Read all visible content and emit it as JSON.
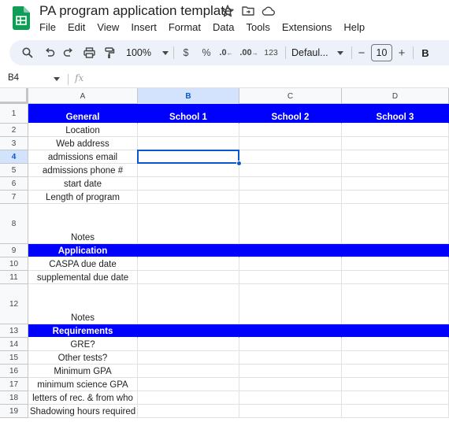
{
  "app": {
    "doc_title": "PA program application template",
    "menu": [
      "File",
      "Edit",
      "View",
      "Insert",
      "Format",
      "Data",
      "Tools",
      "Extensions",
      "Help"
    ]
  },
  "toolbar": {
    "zoom": "100%",
    "currency": "$",
    "percent": "%",
    "decrease_decimal": ".0",
    "increase_decimal": ".00",
    "number_format": "123",
    "font": "Defaul...",
    "font_size": "10",
    "minus": "−",
    "plus": "+",
    "bold": "B"
  },
  "formula_bar": {
    "cell_ref": "B4",
    "fx": "fx"
  },
  "grid": {
    "selected_cell": "B4",
    "header_color": "#0000ff",
    "columns": [
      "A",
      "B",
      "C",
      "D"
    ],
    "rows": [
      {
        "num": "1",
        "cells": [
          "General",
          "School 1",
          "School 2",
          "School 3"
        ],
        "header": true
      },
      {
        "num": "2",
        "cells": [
          "Location",
          "",
          "",
          ""
        ]
      },
      {
        "num": "3",
        "cells": [
          "Web address",
          "",
          "",
          ""
        ]
      },
      {
        "num": "4",
        "cells": [
          "admissions email",
          "",
          "",
          ""
        ]
      },
      {
        "num": "5",
        "cells": [
          "admissions phone #",
          "",
          "",
          ""
        ]
      },
      {
        "num": "6",
        "cells": [
          "start date",
          "",
          "",
          ""
        ]
      },
      {
        "num": "7",
        "cells": [
          "Length of program",
          "",
          "",
          ""
        ]
      },
      {
        "num": "8",
        "cells": [
          "Notes",
          "",
          "",
          ""
        ]
      },
      {
        "num": "9",
        "cells": [
          "Application",
          "",
          "",
          ""
        ],
        "header": true
      },
      {
        "num": "10",
        "cells": [
          "CASPA due date",
          "",
          "",
          ""
        ]
      },
      {
        "num": "11",
        "cells": [
          "supplemental due date",
          "",
          "",
          ""
        ]
      },
      {
        "num": "12",
        "cells": [
          "Notes",
          "",
          "",
          ""
        ]
      },
      {
        "num": "13",
        "cells": [
          "Requirements",
          "",
          "",
          ""
        ],
        "header": true
      },
      {
        "num": "14",
        "cells": [
          "GRE?",
          "",
          "",
          ""
        ]
      },
      {
        "num": "15",
        "cells": [
          "Other tests?",
          "",
          "",
          ""
        ]
      },
      {
        "num": "16",
        "cells": [
          "Minimum GPA",
          "",
          "",
          ""
        ]
      },
      {
        "num": "17",
        "cells": [
          "minimum science GPA",
          "",
          "",
          ""
        ]
      },
      {
        "num": "18",
        "cells": [
          "letters of rec. & from who",
          "",
          "",
          ""
        ]
      },
      {
        "num": "19",
        "cells": [
          "Shadowing hours required",
          "",
          "",
          ""
        ]
      }
    ]
  }
}
